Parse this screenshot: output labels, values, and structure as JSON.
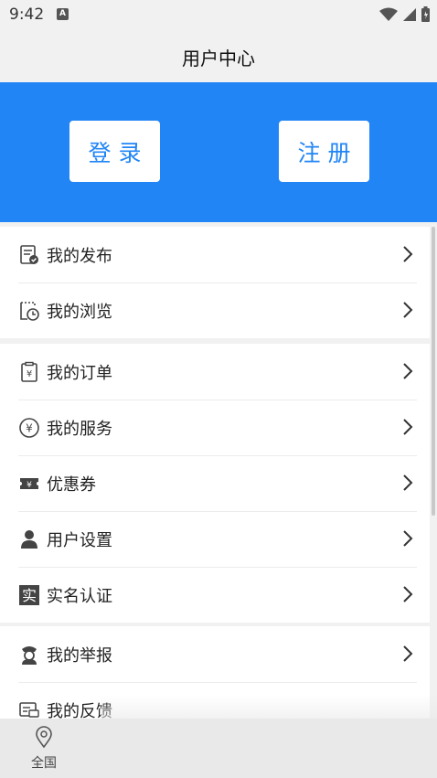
{
  "status_bar": {
    "time": "9:42",
    "notification_glyph": "A"
  },
  "header": {
    "title": "用户中心"
  },
  "hero": {
    "login_label": "登录",
    "register_label": "注册",
    "background_color": "#2185f5"
  },
  "groups": [
    {
      "items": [
        {
          "label": "我的发布",
          "icon": "publish-doc-icon"
        },
        {
          "label": "我的浏览",
          "icon": "history-clock-icon"
        }
      ]
    },
    {
      "items": [
        {
          "label": "我的订单",
          "icon": "order-clipboard-icon"
        },
        {
          "label": "我的服务",
          "icon": "yuan-coin-icon"
        },
        {
          "label": "优惠券",
          "icon": "coupon-icon"
        },
        {
          "label": "用户设置",
          "icon": "user-icon"
        },
        {
          "label": "实名认证",
          "icon": "real-name-icon",
          "icon_text": "实"
        }
      ]
    },
    {
      "items": [
        {
          "label": "我的举报",
          "icon": "police-icon"
        },
        {
          "label": "我的反馈",
          "icon": "feedback-icon"
        }
      ]
    }
  ],
  "bottom_nav": {
    "items": [
      {
        "label": "全国",
        "icon": "location-pin-icon"
      }
    ]
  }
}
